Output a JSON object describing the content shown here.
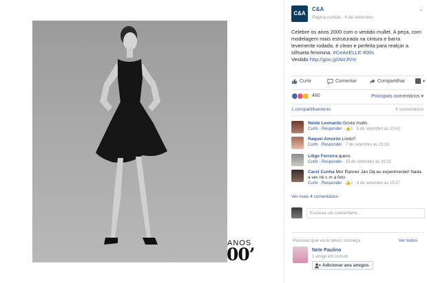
{
  "photo": {
    "caption_top": "ANOS",
    "caption_bottom": "00’"
  },
  "post": {
    "page_name": "C&A",
    "logo_text": "C&A",
    "meta": "Página curtida · 4 de setembro",
    "text": "Celebre os anos 2000 com o vestido mullet. A peça, com modelagem mais estruturada na cintura e barra levemente rodada, é clean e perfeita para realçar a silhueta feminina. ",
    "hashtags": "#CeAeELLE #00s",
    "link_prefix": "Vestido ",
    "link": "http://goo.gl/Akr3Vm"
  },
  "actions": {
    "like": "Curtir",
    "comment": "Comentar",
    "share": "Compartilhar"
  },
  "reactions": {
    "count": "480",
    "sort": "Principais comentários ▾",
    "colors": {
      "like": "#4267b2",
      "love": "#f25268",
      "wow": "#f7b928"
    }
  },
  "summary": {
    "shares": "1 compartilhamento",
    "comments": "8 comentários"
  },
  "comments": [
    {
      "name": "Neide Leonardo",
      "text": "Gosto muito",
      "actions": "Curtir · Responder · ",
      "likes": "1",
      "time": " · 5 de setembro às 10:42"
    },
    {
      "name": "Raquel Amorim",
      "text": "Lindo!!",
      "actions": "Curtir · Responder · ",
      "likes": "",
      "time": "7 de setembro às 23:16"
    },
    {
      "name": "Lilige Ferreira",
      "text": "quero",
      "actions": "Curtir · Responder · ",
      "likes": "",
      "time": "15 de setembro às 23:22"
    },
    {
      "name": "Carol Cunha",
      "text": "Mor Ranner Jan Oq eu experimentei! Nada a ver né c m a foto",
      "actions": "Curtir · Responder · ",
      "likes": "2",
      "time": " · 4 de setembro às 15:27"
    }
  ],
  "more_comments": "Ver mais 4 comentários",
  "write": {
    "placeholder": "Escreva um comentário..."
  },
  "suggestions": {
    "title": "Pessoas que você talvez conheça",
    "see_all": "Ver todos",
    "name": "Nete Paulino",
    "mutual": "1 amigo em comum",
    "add": "Adicionar aos amigos"
  }
}
